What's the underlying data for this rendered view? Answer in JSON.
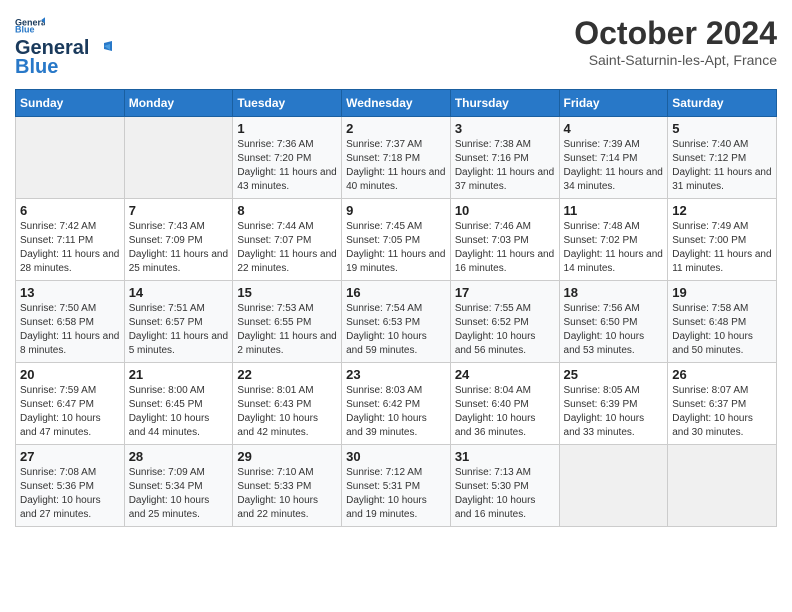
{
  "header": {
    "logo_line1": "General",
    "logo_line2": "Blue",
    "month": "October 2024",
    "location": "Saint-Saturnin-les-Apt, France"
  },
  "calendar": {
    "weekdays": [
      "Sunday",
      "Monday",
      "Tuesday",
      "Wednesday",
      "Thursday",
      "Friday",
      "Saturday"
    ],
    "weeks": [
      [
        {
          "day": "",
          "info": ""
        },
        {
          "day": "",
          "info": ""
        },
        {
          "day": "1",
          "info": "Sunrise: 7:36 AM\nSunset: 7:20 PM\nDaylight: 11 hours and 43 minutes."
        },
        {
          "day": "2",
          "info": "Sunrise: 7:37 AM\nSunset: 7:18 PM\nDaylight: 11 hours and 40 minutes."
        },
        {
          "day": "3",
          "info": "Sunrise: 7:38 AM\nSunset: 7:16 PM\nDaylight: 11 hours and 37 minutes."
        },
        {
          "day": "4",
          "info": "Sunrise: 7:39 AM\nSunset: 7:14 PM\nDaylight: 11 hours and 34 minutes."
        },
        {
          "day": "5",
          "info": "Sunrise: 7:40 AM\nSunset: 7:12 PM\nDaylight: 11 hours and 31 minutes."
        }
      ],
      [
        {
          "day": "6",
          "info": "Sunrise: 7:42 AM\nSunset: 7:11 PM\nDaylight: 11 hours and 28 minutes."
        },
        {
          "day": "7",
          "info": "Sunrise: 7:43 AM\nSunset: 7:09 PM\nDaylight: 11 hours and 25 minutes."
        },
        {
          "day": "8",
          "info": "Sunrise: 7:44 AM\nSunset: 7:07 PM\nDaylight: 11 hours and 22 minutes."
        },
        {
          "day": "9",
          "info": "Sunrise: 7:45 AM\nSunset: 7:05 PM\nDaylight: 11 hours and 19 minutes."
        },
        {
          "day": "10",
          "info": "Sunrise: 7:46 AM\nSunset: 7:03 PM\nDaylight: 11 hours and 16 minutes."
        },
        {
          "day": "11",
          "info": "Sunrise: 7:48 AM\nSunset: 7:02 PM\nDaylight: 11 hours and 14 minutes."
        },
        {
          "day": "12",
          "info": "Sunrise: 7:49 AM\nSunset: 7:00 PM\nDaylight: 11 hours and 11 minutes."
        }
      ],
      [
        {
          "day": "13",
          "info": "Sunrise: 7:50 AM\nSunset: 6:58 PM\nDaylight: 11 hours and 8 minutes."
        },
        {
          "day": "14",
          "info": "Sunrise: 7:51 AM\nSunset: 6:57 PM\nDaylight: 11 hours and 5 minutes."
        },
        {
          "day": "15",
          "info": "Sunrise: 7:53 AM\nSunset: 6:55 PM\nDaylight: 11 hours and 2 minutes."
        },
        {
          "day": "16",
          "info": "Sunrise: 7:54 AM\nSunset: 6:53 PM\nDaylight: 10 hours and 59 minutes."
        },
        {
          "day": "17",
          "info": "Sunrise: 7:55 AM\nSunset: 6:52 PM\nDaylight: 10 hours and 56 minutes."
        },
        {
          "day": "18",
          "info": "Sunrise: 7:56 AM\nSunset: 6:50 PM\nDaylight: 10 hours and 53 minutes."
        },
        {
          "day": "19",
          "info": "Sunrise: 7:58 AM\nSunset: 6:48 PM\nDaylight: 10 hours and 50 minutes."
        }
      ],
      [
        {
          "day": "20",
          "info": "Sunrise: 7:59 AM\nSunset: 6:47 PM\nDaylight: 10 hours and 47 minutes."
        },
        {
          "day": "21",
          "info": "Sunrise: 8:00 AM\nSunset: 6:45 PM\nDaylight: 10 hours and 44 minutes."
        },
        {
          "day": "22",
          "info": "Sunrise: 8:01 AM\nSunset: 6:43 PM\nDaylight: 10 hours and 42 minutes."
        },
        {
          "day": "23",
          "info": "Sunrise: 8:03 AM\nSunset: 6:42 PM\nDaylight: 10 hours and 39 minutes."
        },
        {
          "day": "24",
          "info": "Sunrise: 8:04 AM\nSunset: 6:40 PM\nDaylight: 10 hours and 36 minutes."
        },
        {
          "day": "25",
          "info": "Sunrise: 8:05 AM\nSunset: 6:39 PM\nDaylight: 10 hours and 33 minutes."
        },
        {
          "day": "26",
          "info": "Sunrise: 8:07 AM\nSunset: 6:37 PM\nDaylight: 10 hours and 30 minutes."
        }
      ],
      [
        {
          "day": "27",
          "info": "Sunrise: 7:08 AM\nSunset: 5:36 PM\nDaylight: 10 hours and 27 minutes."
        },
        {
          "day": "28",
          "info": "Sunrise: 7:09 AM\nSunset: 5:34 PM\nDaylight: 10 hours and 25 minutes."
        },
        {
          "day": "29",
          "info": "Sunrise: 7:10 AM\nSunset: 5:33 PM\nDaylight: 10 hours and 22 minutes."
        },
        {
          "day": "30",
          "info": "Sunrise: 7:12 AM\nSunset: 5:31 PM\nDaylight: 10 hours and 19 minutes."
        },
        {
          "day": "31",
          "info": "Sunrise: 7:13 AM\nSunset: 5:30 PM\nDaylight: 10 hours and 16 minutes."
        },
        {
          "day": "",
          "info": ""
        },
        {
          "day": "",
          "info": ""
        }
      ]
    ]
  }
}
